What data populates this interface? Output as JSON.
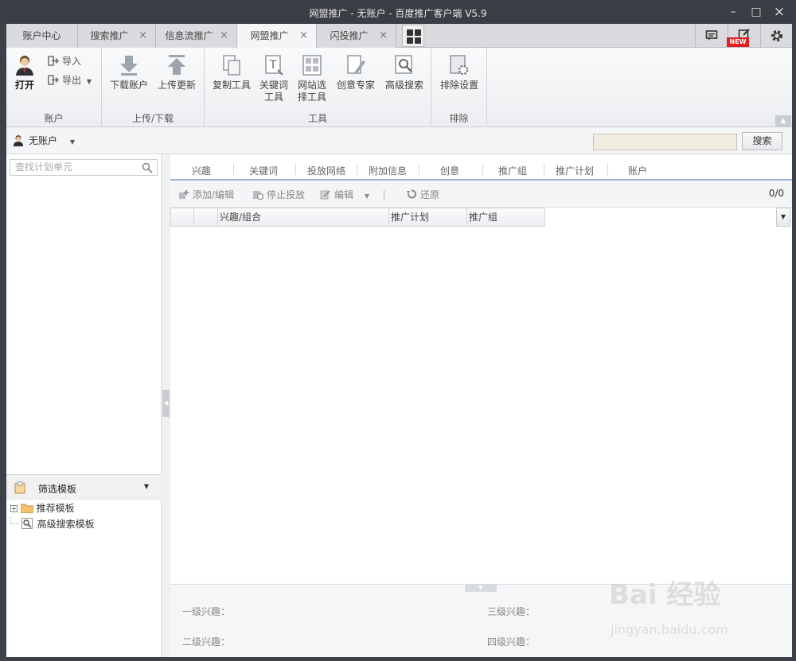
{
  "window": {
    "title": "网盟推广 - 无账户 - 百度推广客户端 V5.9",
    "min": "–",
    "max": "□",
    "close": "×"
  },
  "tabs": [
    {
      "label": "账户中心",
      "closable": false
    },
    {
      "label": "搜索推广",
      "closable": true
    },
    {
      "label": "信息流推广",
      "closable": true
    },
    {
      "label": "网盟推广",
      "closable": true,
      "active": true
    },
    {
      "label": "闪投推广",
      "closable": true
    }
  ],
  "close_glyph": "×",
  "badge": "NEW",
  "ribbon": {
    "account": {
      "open": "打开",
      "import": "导入",
      "export": "导出",
      "group": "账户"
    },
    "transfer": {
      "download": "下载账户",
      "upload": "上传更新",
      "group": "上传/下载"
    },
    "tools": {
      "copy": "复制工具",
      "keyword_1": "关键词",
      "keyword_2": "工具",
      "site_1": "网站选",
      "site_2": "择工具",
      "creative": "创意专家",
      "advanced": "高级搜索",
      "group": "工具"
    },
    "exclude": {
      "settings": "排除设置",
      "group": "排除"
    }
  },
  "account_bar": {
    "account": "无账户",
    "search_value": "",
    "search_button": "搜索"
  },
  "left": {
    "search_placeholder": "查找计划单元",
    "filter_title": "筛选模板",
    "tree": [
      "推荐模板",
      "高级搜索模板"
    ]
  },
  "subtabs": [
    "兴趣",
    "关键词",
    "投放网络",
    "附加信息",
    "创意",
    "推广组",
    "推广计划",
    "账户"
  ],
  "toolbar": {
    "add_edit": "添加/编辑",
    "stop": "停止投放",
    "edit": "编辑",
    "restore": "还原",
    "count": "0/0"
  },
  "grid": {
    "columns": [
      "兴趣/组合",
      "推广计划",
      "推广组"
    ]
  },
  "detail": {
    "level1": "一级兴趣：",
    "level2": "二级兴趣：",
    "level3": "三级兴趣：",
    "level4": "四级兴趣："
  },
  "watermark": {
    "brand": "Bai 经验",
    "url": "jingyan.baidu.com"
  }
}
